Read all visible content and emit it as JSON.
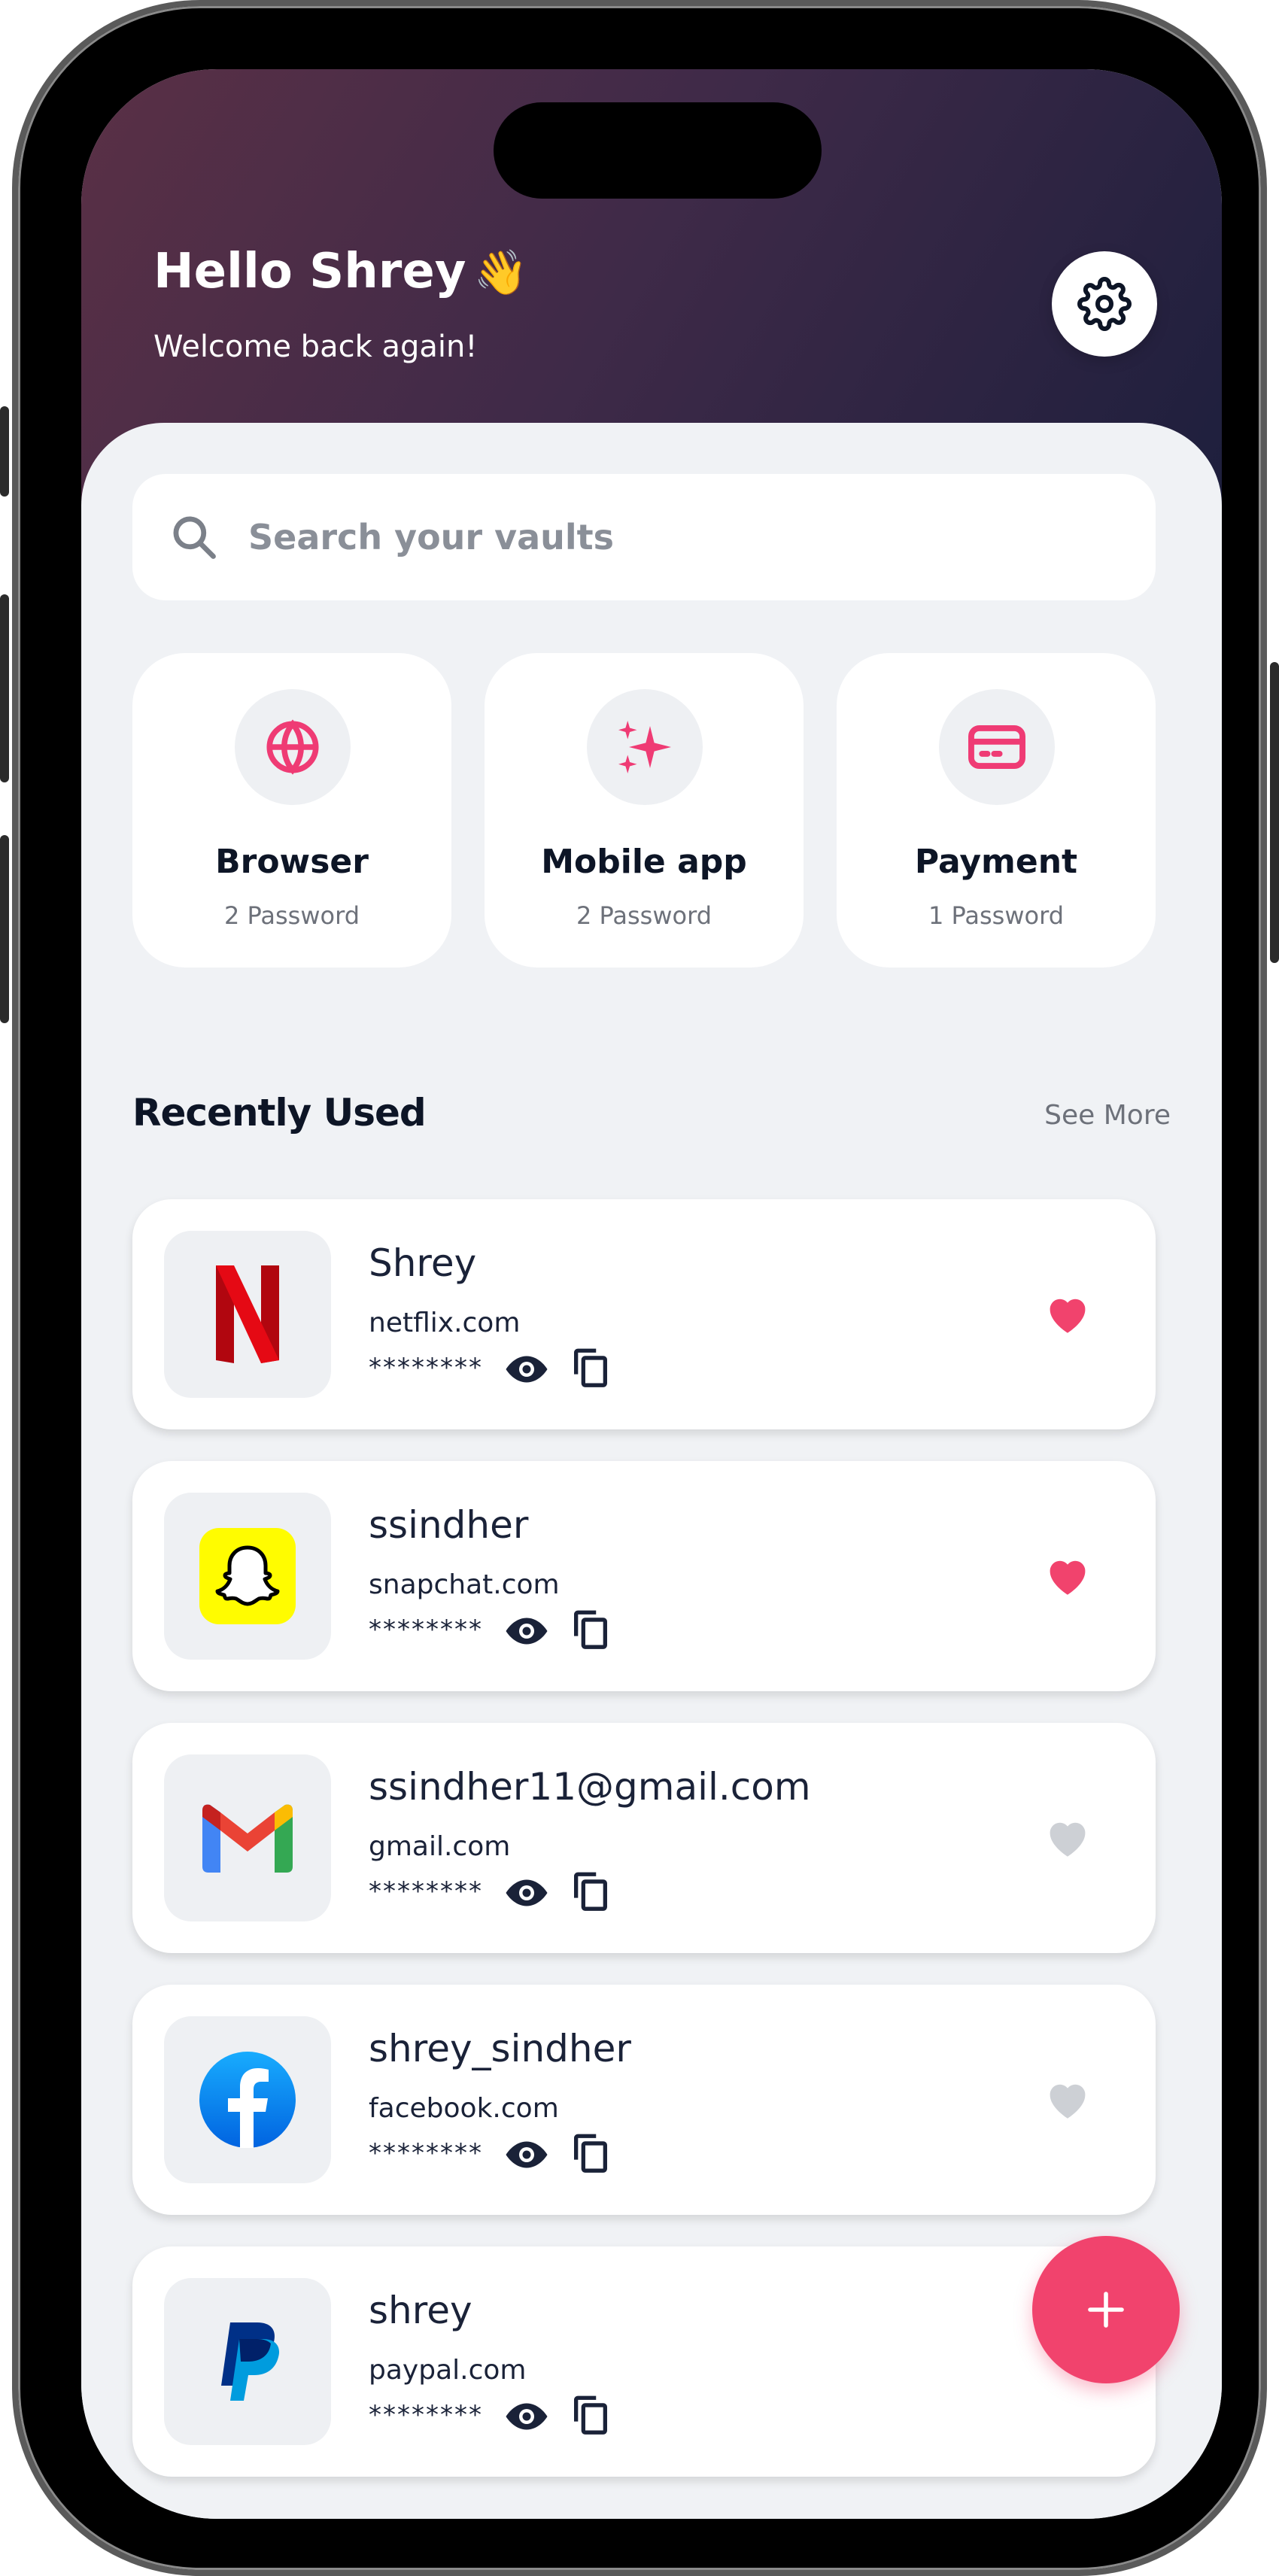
{
  "header": {
    "greeting": "Hello Shrey",
    "greeting_emoji": "👋",
    "subtitle": "Welcome back again!",
    "settings_icon": "gear-icon"
  },
  "search": {
    "placeholder": "Search your vaults",
    "icon": "search-icon"
  },
  "categories": [
    {
      "name": "Browser",
      "count": "2 Password",
      "icon": "globe-icon"
    },
    {
      "name": "Mobile app",
      "count": "2 Password",
      "icon": "sparkles-icon"
    },
    {
      "name": "Payment",
      "count": "1 Password",
      "icon": "credit-card-icon"
    }
  ],
  "recent": {
    "title": "Recently Used",
    "see_more": "See More",
    "items": [
      {
        "username": "Shrey",
        "domain": "netflix.com",
        "password_mask": "********",
        "logo": "netflix-logo",
        "favorite": true
      },
      {
        "username": "ssindher",
        "domain": "snapchat.com",
        "password_mask": "********",
        "logo": "snapchat-logo",
        "favorite": true
      },
      {
        "username": "ssindher11@gmail.com",
        "domain": "gmail.com",
        "password_mask": "********",
        "logo": "gmail-logo",
        "favorite": false
      },
      {
        "username": "shrey_sindher",
        "domain": "facebook.com",
        "password_mask": "********",
        "logo": "facebook-logo",
        "favorite": false
      },
      {
        "username": "shrey",
        "domain": "paypal.com",
        "password_mask": "********",
        "logo": "paypal-logo",
        "favorite": null
      }
    ]
  },
  "fab": {
    "icon": "plus-icon",
    "label": "+"
  },
  "colors": {
    "accent": "#f1436d",
    "header_gradient_start": "#5a3046",
    "header_gradient_end": "#1b1e3c",
    "favorite_on": "#f1436d",
    "favorite_off": "#cdd0d5",
    "text_dark": "#1a2238",
    "background": "#f0f2f5"
  }
}
